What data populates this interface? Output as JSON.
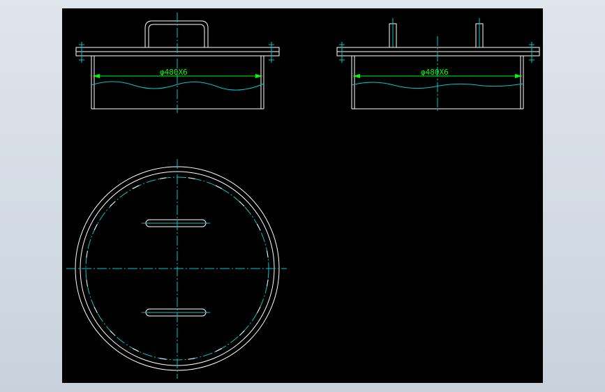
{
  "drawing": {
    "front_view": {
      "dimension_label": "φ480X6"
    },
    "side_view": {
      "dimension_label": "φ480X6"
    }
  },
  "colors": {
    "background": "#000000",
    "outline": "#ffffff",
    "centerline": "#00c8c8",
    "dimension": "#00ff00",
    "frame": "#d2dae3"
  }
}
